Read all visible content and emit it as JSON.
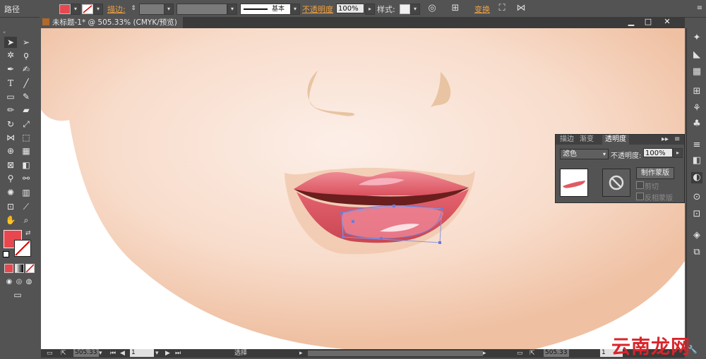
{
  "control_bar": {
    "object_type": "路径",
    "fill_color": "#e8474f",
    "stroke_label": "描边:",
    "stroke_profile": "基本",
    "opacity_label": "不透明度",
    "opacity_value": "100%",
    "style_label": "样式:",
    "transform_label": "变换"
  },
  "document": {
    "tab_title": "未标题-1* @ 505.33% (CMYK/预览)",
    "minimize": "▁",
    "restore": "□",
    "close": "✕"
  },
  "toolbox": {
    "fill_color": "#e8474f",
    "tools": [
      "selection-tool",
      "direct-selection-tool",
      "magic-wand-tool",
      "lasso-tool",
      "pen-tool",
      "curvature-tool",
      "type-tool",
      "line-tool",
      "rectangle-tool",
      "paintbrush-tool",
      "pencil-tool",
      "eraser-tool",
      "rotate-tool",
      "scale-tool",
      "width-tool",
      "free-transform-tool",
      "shape-builder-tool",
      "perspective-grid-tool",
      "mesh-tool",
      "gradient-tool",
      "eyedropper-tool",
      "blend-tool",
      "symbol-sprayer-tool",
      "column-graph-tool",
      "artboard-tool",
      "slice-tool",
      "hand-tool",
      "zoom-tool"
    ]
  },
  "transparency_panel": {
    "tabs": [
      "描边",
      "渐变",
      "透明度"
    ],
    "active_tab": "透明度",
    "blend_mode": "滤色",
    "opacity_label": "不透明度:",
    "opacity_value": "100%",
    "make_mask_button": "制作蒙版",
    "clip_label": "剪切",
    "invert_mask_label": "反相蒙版"
  },
  "status_bar": {
    "zoom": "505.33",
    "page": "1",
    "tool_status": "选择",
    "zoom_right": "505.33",
    "page_right": "1"
  },
  "watermark": "云南龙网",
  "colors": {
    "skin_light": "#fbe8de",
    "skin_dark": "#ecb894",
    "lip_main": "#e05a62",
    "lip_dark": "#6a1e1e",
    "lip_highlight": "#f7b8c4"
  }
}
